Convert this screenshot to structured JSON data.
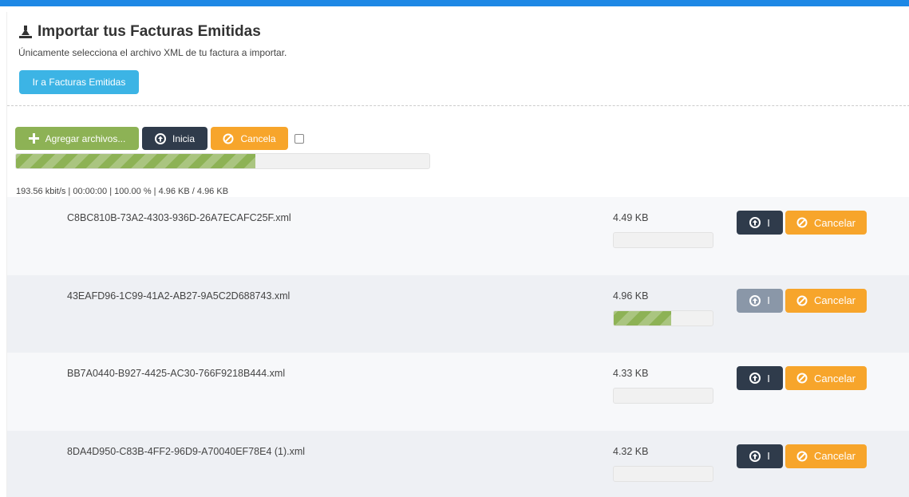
{
  "header": {
    "title": "Importar tus Facturas Emitidas",
    "subtitle": "Únicamente selecciona el archivo XML de tu factura a importar.",
    "go_button": "Ir a Facturas Emitidas",
    "icon": "import-icon"
  },
  "toolbar": {
    "add_label": "Agregar archivos...",
    "start_label": "Inicia",
    "cancel_label": "Cancela",
    "global_progress": 0.58
  },
  "stats": "193.56 kbit/s | 00:00:00 | 100.00 % | 4.96 KB / 4.96 KB",
  "colors": {
    "topbar": "#1e88e5",
    "info": "#3cb4e5",
    "success": "#8db255",
    "dark": "#2f3b4b",
    "warning": "#f7a52b"
  },
  "files": [
    {
      "name": "C8BC810B-73A2-4303-936D-26A7ECAFC25F.xml",
      "size": "4.49 KB",
      "progress": 0,
      "start_label": "I",
      "start_disabled": false,
      "cancel_label": "Cancelar"
    },
    {
      "name": "43EAFD96-1C99-41A2-AB27-9A5C2D688743.xml",
      "size": "4.96 KB",
      "progress": 0.58,
      "start_label": "I",
      "start_disabled": true,
      "cancel_label": "Cancelar"
    },
    {
      "name": "BB7A0440-B927-4425-AC30-766F9218B444.xml",
      "size": "4.33 KB",
      "progress": 0,
      "start_label": "I",
      "start_disabled": false,
      "cancel_label": "Cancelar"
    },
    {
      "name": "8DA4D950-C83B-4FF2-96D9-A70040EF78E4 (1).xml",
      "size": "4.32 KB",
      "progress": 0,
      "start_label": "I",
      "start_disabled": false,
      "cancel_label": "Cancelar"
    }
  ]
}
